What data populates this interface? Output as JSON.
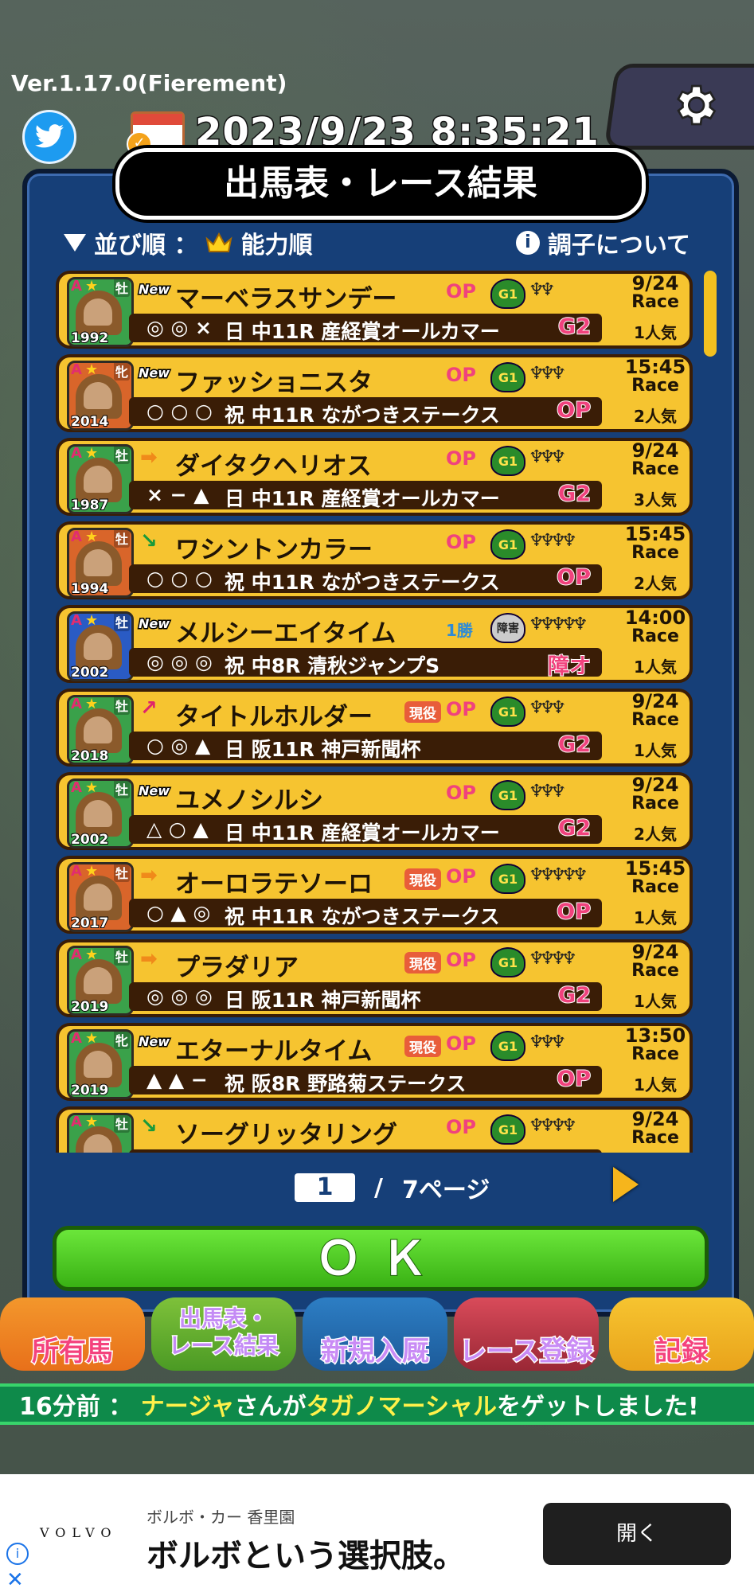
{
  "app": {
    "version": "Ver.1.17.0(Fierement)",
    "datetime": "2023/9/23 8:35:21"
  },
  "dialog": {
    "title": "出馬表・レース結果",
    "sort_label": "並び順 ：",
    "sort_value": "能力順",
    "condition_link": "調子について"
  },
  "rows": [
    {
      "grade": "A",
      "sex": "牡",
      "year": "1992",
      "tag": "New",
      "arrow": "",
      "name": "マーベラスサンデー",
      "genki": "",
      "cls": "OP",
      "g1": "G1",
      "shoes": "♆♆",
      "time": "9/24",
      "race": "Race",
      "marks": "◎ ◎ ×",
      "day": "日",
      "race_name": "中11R 産経賞オールカマー",
      "grade2": "G2",
      "pop": "1人気",
      "color": "#3aa14a"
    },
    {
      "grade": "A",
      "sex": "牝",
      "year": "2014",
      "tag": "New",
      "arrow": "",
      "name": "ファッショニスタ",
      "genki": "",
      "cls": "OP",
      "g1": "G1",
      "shoes": "♆♆♆",
      "time": "15:45",
      "race": "Race",
      "marks": "○ ○ ○",
      "day": "祝",
      "race_name": "中11R ながつきステークス",
      "grade2": "OP",
      "pop": "2人気",
      "color": "#d9652a"
    },
    {
      "grade": "A",
      "sex": "牡",
      "year": "1987",
      "tag": "",
      "arrow": "➡",
      "name": "ダイタクヘリオス",
      "genki": "",
      "cls": "OP",
      "g1": "G1",
      "shoes": "♆♆♆",
      "time": "9/24",
      "race": "Race",
      "marks": "× − ▲",
      "day": "日",
      "race_name": "中11R 産経賞オールカマー",
      "grade2": "G2",
      "pop": "3人気",
      "color": "#3aa14a"
    },
    {
      "grade": "A",
      "sex": "牡",
      "year": "1994",
      "tag": "",
      "arrow": "↘",
      "name": "ワシントンカラー",
      "genki": "",
      "cls": "OP",
      "g1": "G1",
      "shoes": "♆♆♆♆",
      "time": "15:45",
      "race": "Race",
      "marks": "○ ○ ○",
      "day": "祝",
      "race_name": "中11R ながつきステークス",
      "grade2": "OP",
      "pop": "2人気",
      "color": "#d9652a"
    },
    {
      "grade": "A",
      "sex": "牡",
      "year": "2002",
      "tag": "New",
      "arrow": "",
      "name": "メルシーエイタイム",
      "genki": "",
      "cls": "1勝",
      "g1": "障害",
      "shoes": "♆♆♆♆♆",
      "time": "14:00",
      "race": "Race",
      "marks": "◎ ◎ ◎",
      "day": "祝",
      "race_name": "中8R 清秋ジャンプS",
      "grade2": "障オ",
      "pop": "1人気",
      "color": "#2a5bc4"
    },
    {
      "grade": "A",
      "sex": "牡",
      "year": "2018",
      "tag": "",
      "arrow": "↗",
      "name": "タイトルホルダー",
      "genki": "現役",
      "cls": "OP",
      "g1": "G1",
      "shoes": "♆♆♆",
      "time": "9/24",
      "race": "Race",
      "marks": "○ ◎ ▲",
      "day": "日",
      "race_name": "阪11R 神戸新聞杯",
      "grade2": "G2",
      "pop": "1人気",
      "color": "#3aa14a"
    },
    {
      "grade": "A",
      "sex": "牡",
      "year": "2002",
      "tag": "New",
      "arrow": "",
      "name": "ユメノシルシ",
      "genki": "",
      "cls": "OP",
      "g1": "G1",
      "shoes": "♆♆♆",
      "time": "9/24",
      "race": "Race",
      "marks": "△ ○ ▲",
      "day": "日",
      "race_name": "中11R 産経賞オールカマー",
      "grade2": "G2",
      "pop": "2人気",
      "color": "#3aa14a"
    },
    {
      "grade": "A",
      "sex": "牡",
      "year": "2017",
      "tag": "",
      "arrow": "➡",
      "name": "オーロラテソーロ",
      "genki": "現役",
      "cls": "OP",
      "g1": "G1",
      "shoes": "♆♆♆♆♆",
      "time": "15:45",
      "race": "Race",
      "marks": "○ ▲ ◎",
      "day": "祝",
      "race_name": "中11R ながつきステークス",
      "grade2": "OP",
      "pop": "1人気",
      "color": "#d9652a"
    },
    {
      "grade": "A",
      "sex": "牡",
      "year": "2019",
      "tag": "",
      "arrow": "➡",
      "name": "プラダリア",
      "genki": "現役",
      "cls": "OP",
      "g1": "G1",
      "shoes": "♆♆♆♆",
      "time": "9/24",
      "race": "Race",
      "marks": "◎ ◎ ◎",
      "day": "日",
      "race_name": "阪11R 神戸新聞杯",
      "grade2": "G2",
      "pop": "1人気",
      "color": "#3aa14a"
    },
    {
      "grade": "A",
      "sex": "牝",
      "year": "2019",
      "tag": "New",
      "arrow": "",
      "name": "エターナルタイム",
      "genki": "現役",
      "cls": "OP",
      "g1": "G1",
      "shoes": "♆♆♆",
      "time": "13:50",
      "race": "Race",
      "marks": "▲ ▲ −",
      "day": "祝",
      "race_name": "阪8R 野路菊ステークス",
      "grade2": "OP",
      "pop": "1人気",
      "color": "#3aa14a"
    },
    {
      "grade": "A",
      "sex": "牡",
      "year": "",
      "tag": "",
      "arrow": "↘",
      "name": "ソーグリッタリング",
      "genki": "",
      "cls": "OP",
      "g1": "G1",
      "shoes": "♆♆♆♆",
      "time": "9/24",
      "race": "Race",
      "marks": "",
      "day": "",
      "race_name": "",
      "grade2": "",
      "pop": "",
      "color": "#3aa14a"
    }
  ],
  "pager": {
    "current": "1",
    "separator": "/",
    "total": "7ページ"
  },
  "ok_label": "ＯＫ",
  "nav": {
    "owned": "所有馬",
    "entries_line1": "出馬表・",
    "entries_line2": "レース結果",
    "new_stable": "新規入厩",
    "race_register": "レース登録",
    "records": "記録"
  },
  "ticker": {
    "time": "16分前 ：",
    "user": "ナージャ",
    "middle": "さんが",
    "horse": "タガノマーシャル",
    "end": "をゲットしました!"
  },
  "ad": {
    "brand": "VOLVO",
    "dealer": "ボルボ・カー 香里園",
    "headline": "ボルボという選択肢。",
    "button": "開く"
  }
}
